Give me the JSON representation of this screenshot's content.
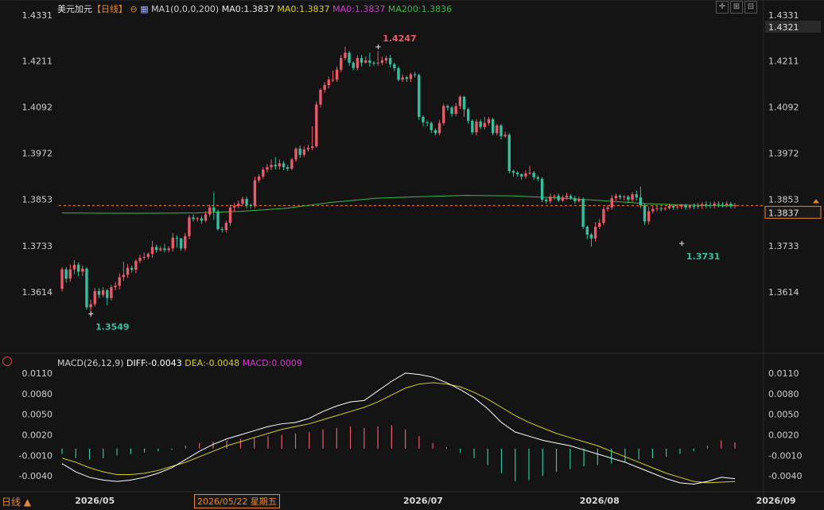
{
  "header": {
    "symbol": "美元加元",
    "period": "【日线】",
    "ma1_label": "MA1(0,0,0,200)",
    "ma0_a": "MA0:1.3837",
    "ma0_b": "MA0:1.3837",
    "ma0_c": "MA0:1.3837",
    "ma200": "MA200:1.3836"
  },
  "macd_header": {
    "label": "MACD(26,12,9)",
    "diff": "DIFF:-0.0043",
    "dea": "DEA:-0.0048",
    "macd": "MACD:0.0009"
  },
  "footer": {
    "period_button": "日线 ▲",
    "crosshair_date": "2026/05/22 星期五"
  },
  "price_axis": {
    "top_value": "1.4331",
    "highlight_value": "1.4321",
    "current_value": "1.3837",
    "ticks": [
      "1.4211",
      "1.4092",
      "1.3972",
      "1.3853",
      "1.3733",
      "1.3614"
    ]
  },
  "macd_axis": {
    "ticks": [
      "0.0110",
      "0.0080",
      "0.0050",
      "0.0020",
      "-0.0010",
      "-0.0040"
    ]
  },
  "colors": {
    "up": "#ef5a6a",
    "down": "#2ec4a0",
    "ma200": "#3cb84a",
    "diff": "#ffffff",
    "dea": "#d8d01c",
    "macd": "#d040d0",
    "accent": "#e8882a"
  },
  "chart_data": {
    "type": "candlestick",
    "price_range": [
      1.348,
      1.4331
    ],
    "x_labels": [
      "2026/05",
      "2026/07",
      "2026/08",
      "2026/09"
    ],
    "x_label_indices": [
      8,
      88,
      131,
      174
    ],
    "high_annotation": {
      "text": "1.4247",
      "index": 77,
      "value": 1.4247
    },
    "low_annotation_1": {
      "text": "1.3549",
      "index": 7,
      "value": 1.3549
    },
    "low_annotation_2": {
      "text": "1.3731",
      "index": 151,
      "value": 1.3731
    },
    "current_price": 1.3837,
    "ma200": [
      1.3818,
      1.3817,
      1.3817,
      1.3818,
      1.3822,
      1.383,
      1.3845,
      1.3856,
      1.386,
      1.3863,
      1.3862,
      1.3857,
      1.385,
      1.3842,
      1.3838,
      1.3836
    ],
    "candles": [
      [
        1.3622,
        1.3672,
        1.3678,
        1.3615
      ],
      [
        1.3672,
        1.3648,
        1.3678,
        1.3638
      ],
      [
        1.3648,
        1.3672,
        1.3685,
        1.364
      ],
      [
        1.3672,
        1.3684,
        1.3696,
        1.366
      ],
      [
        1.3684,
        1.3666,
        1.369,
        1.3655
      ],
      [
        1.3666,
        1.3674,
        1.3682,
        1.3655
      ],
      [
        1.3674,
        1.3574,
        1.3678,
        1.3568
      ],
      [
        1.3574,
        1.3582,
        1.3594,
        1.3549
      ],
      [
        1.3582,
        1.3616,
        1.3624,
        1.3576
      ],
      [
        1.3616,
        1.3606,
        1.3624,
        1.3598
      ],
      [
        1.3606,
        1.3618,
        1.3626,
        1.36
      ],
      [
        1.3618,
        1.3598,
        1.3622,
        1.358
      ],
      [
        1.3598,
        1.3626,
        1.3632,
        1.3592
      ],
      [
        1.3626,
        1.363,
        1.364,
        1.3618
      ],
      [
        1.363,
        1.3652,
        1.3662,
        1.362
      ],
      [
        1.3652,
        1.3658,
        1.3692,
        1.3642
      ],
      [
        1.3658,
        1.3676,
        1.3686,
        1.365
      ],
      [
        1.3676,
        1.3671,
        1.3682,
        1.3664
      ],
      [
        1.3671,
        1.3694,
        1.3698,
        1.3662
      ],
      [
        1.3694,
        1.3702,
        1.371,
        1.3688
      ],
      [
        1.3702,
        1.3704,
        1.3716,
        1.3696
      ],
      [
        1.3704,
        1.3712,
        1.3716,
        1.3698
      ],
      [
        1.3712,
        1.373,
        1.3746,
        1.3702
      ],
      [
        1.373,
        1.3722,
        1.3736,
        1.3715
      ],
      [
        1.3722,
        1.3726,
        1.3732,
        1.3718
      ],
      [
        1.3726,
        1.3722,
        1.3738,
        1.3716
      ],
      [
        1.3722,
        1.3726,
        1.3732,
        1.3716
      ],
      [
        1.3726,
        1.3754,
        1.3766,
        1.3718
      ],
      [
        1.3754,
        1.3752,
        1.376,
        1.3728
      ],
      [
        1.3752,
        1.3726,
        1.3754,
        1.372
      ],
      [
        1.3726,
        1.3758,
        1.3766,
        1.372
      ],
      [
        1.3758,
        1.3806,
        1.3812,
        1.375
      ],
      [
        1.3806,
        1.3802,
        1.3814,
        1.3796
      ],
      [
        1.3802,
        1.3804,
        1.3808,
        1.3796
      ],
      [
        1.3804,
        1.3798,
        1.381,
        1.379
      ],
      [
        1.3798,
        1.3814,
        1.3822,
        1.3794
      ],
      [
        1.3814,
        1.3832,
        1.384,
        1.3808
      ],
      [
        1.3832,
        1.3822,
        1.3872,
        1.38
      ],
      [
        1.3822,
        1.3776,
        1.3826,
        1.3772
      ],
      [
        1.3776,
        1.3774,
        1.3782,
        1.3768
      ],
      [
        1.3774,
        1.3792,
        1.3798,
        1.3768
      ],
      [
        1.3792,
        1.3832,
        1.384,
        1.3784
      ],
      [
        1.3832,
        1.3836,
        1.3844,
        1.382
      ],
      [
        1.3836,
        1.3842,
        1.385,
        1.383
      ],
      [
        1.3842,
        1.3854,
        1.386,
        1.3836
      ],
      [
        1.3854,
        1.3838,
        1.386,
        1.383
      ],
      [
        1.3838,
        1.3836,
        1.3842,
        1.383
      ],
      [
        1.3836,
        1.3902,
        1.3912,
        1.383
      ],
      [
        1.3902,
        1.3912,
        1.3918,
        1.3896
      ],
      [
        1.3912,
        1.393,
        1.3936,
        1.3906
      ],
      [
        1.393,
        1.3936,
        1.3944,
        1.3922
      ],
      [
        1.3936,
        1.3942,
        1.3956,
        1.3928
      ],
      [
        1.3942,
        1.3938,
        1.3962,
        1.393
      ],
      [
        1.3938,
        1.3946,
        1.3956,
        1.393
      ],
      [
        1.3946,
        1.3936,
        1.3952,
        1.3928
      ],
      [
        1.3936,
        1.3932,
        1.3942,
        1.3926
      ],
      [
        1.3932,
        1.3956,
        1.396,
        1.3928
      ],
      [
        1.3956,
        1.3984,
        1.3988,
        1.395
      ],
      [
        1.3984,
        1.3968,
        1.3992,
        1.396
      ],
      [
        1.3968,
        1.3982,
        1.399,
        1.3962
      ],
      [
        1.3982,
        1.3986,
        1.3994,
        1.3976
      ],
      [
        1.3986,
        1.399,
        1.4042,
        1.398
      ],
      [
        1.399,
        1.4098,
        1.4106,
        1.3986
      ],
      [
        1.4098,
        1.4136,
        1.414,
        1.409
      ],
      [
        1.4136,
        1.4148,
        1.4156,
        1.4128
      ],
      [
        1.4148,
        1.4162,
        1.417,
        1.414
      ],
      [
        1.4162,
        1.4162,
        1.4186,
        1.4156
      ],
      [
        1.4162,
        1.4188,
        1.4196,
        1.4156
      ],
      [
        1.4188,
        1.4218,
        1.4226,
        1.4182
      ],
      [
        1.4218,
        1.4232,
        1.4247,
        1.4212
      ],
      [
        1.4232,
        1.4206,
        1.4236,
        1.4198
      ],
      [
        1.4206,
        1.4192,
        1.421,
        1.4186
      ],
      [
        1.4192,
        1.4218,
        1.4224,
        1.4186
      ],
      [
        1.4218,
        1.4206,
        1.4226,
        1.4196
      ],
      [
        1.4206,
        1.4212,
        1.4222,
        1.4204
      ],
      [
        1.4212,
        1.4206,
        1.4232,
        1.4196
      ],
      [
        1.4206,
        1.4204,
        1.421,
        1.4198
      ],
      [
        1.4204,
        1.4206,
        1.4236,
        1.4198
      ],
      [
        1.4206,
        1.4212,
        1.4222,
        1.42
      ],
      [
        1.4212,
        1.4218,
        1.4224,
        1.4204
      ],
      [
        1.4218,
        1.4202,
        1.4226,
        1.4194
      ],
      [
        1.4202,
        1.4192,
        1.4206,
        1.4184
      ],
      [
        1.4192,
        1.4162,
        1.4196,
        1.4158
      ],
      [
        1.4162,
        1.4168,
        1.4176,
        1.4156
      ],
      [
        1.4168,
        1.4164,
        1.4172,
        1.4156
      ],
      [
        1.4164,
        1.4176,
        1.418,
        1.4156
      ],
      [
        1.4176,
        1.4174,
        1.4182,
        1.4168
      ],
      [
        1.4174,
        1.4066,
        1.4178,
        1.4058
      ],
      [
        1.4066,
        1.4052,
        1.407,
        1.4042
      ],
      [
        1.4052,
        1.405,
        1.4056,
        1.4042
      ],
      [
        1.405,
        1.4032,
        1.4054,
        1.4024
      ],
      [
        1.4032,
        1.4024,
        1.4036,
        1.4018
      ],
      [
        1.4024,
        1.405,
        1.4058,
        1.4018
      ],
      [
        1.405,
        1.4094,
        1.41,
        1.4044
      ],
      [
        1.4094,
        1.409,
        1.4098,
        1.4082
      ],
      [
        1.409,
        1.4074,
        1.4094,
        1.4066
      ],
      [
        1.4074,
        1.4094,
        1.4102,
        1.4068
      ],
      [
        1.4094,
        1.4118,
        1.4122,
        1.4086
      ],
      [
        1.4118,
        1.4086,
        1.412,
        1.4066
      ],
      [
        1.4086,
        1.4056,
        1.409,
        1.4048
      ],
      [
        1.4056,
        1.4026,
        1.406,
        1.402
      ],
      [
        1.4026,
        1.4054,
        1.406,
        1.4018
      ],
      [
        1.4054,
        1.404,
        1.406,
        1.4034
      ],
      [
        1.404,
        1.405,
        1.4066,
        1.4034
      ],
      [
        1.405,
        1.406,
        1.4066,
        1.4044
      ],
      [
        1.406,
        1.4024,
        1.4064,
        1.4018
      ],
      [
        1.4024,
        1.4044,
        1.4048,
        1.4018
      ],
      [
        1.4044,
        1.4016,
        1.4048,
        1.4008
      ],
      [
        1.4016,
        1.402,
        1.4028,
        1.4012
      ],
      [
        1.402,
        1.3926,
        1.4024,
        1.392
      ],
      [
        1.3926,
        1.3922,
        1.393,
        1.3912
      ],
      [
        1.3922,
        1.3918,
        1.3926,
        1.3912
      ],
      [
        1.3918,
        1.3912,
        1.392,
        1.3904
      ],
      [
        1.3912,
        1.392,
        1.3928,
        1.3906
      ],
      [
        1.392,
        1.3922,
        1.394,
        1.3916
      ],
      [
        1.3922,
        1.391,
        1.3926,
        1.3904
      ],
      [
        1.391,
        1.3906,
        1.3914,
        1.39
      ],
      [
        1.3906,
        1.3852,
        1.391,
        1.3846
      ],
      [
        1.3852,
        1.3848,
        1.3856,
        1.3842
      ],
      [
        1.3848,
        1.386,
        1.3868,
        1.3842
      ],
      [
        1.386,
        1.3862,
        1.3866,
        1.3852
      ],
      [
        1.3862,
        1.385,
        1.3868,
        1.3846
      ],
      [
        1.385,
        1.3858,
        1.3864,
        1.3846
      ],
      [
        1.3858,
        1.3862,
        1.387,
        1.3852
      ],
      [
        1.3862,
        1.3856,
        1.3866,
        1.3852
      ],
      [
        1.3856,
        1.3848,
        1.3862,
        1.3842
      ],
      [
        1.3848,
        1.3854,
        1.386,
        1.3844
      ],
      [
        1.3854,
        1.3782,
        1.3858,
        1.3776
      ],
      [
        1.3782,
        1.3762,
        1.3786,
        1.375
      ],
      [
        1.3762,
        1.3752,
        1.3766,
        1.3731
      ],
      [
        1.3752,
        1.3782,
        1.3794,
        1.3744
      ],
      [
        1.3782,
        1.3792,
        1.3802,
        1.3776
      ],
      [
        1.3792,
        1.3828,
        1.3834,
        1.3786
      ],
      [
        1.3828,
        1.3832,
        1.3838,
        1.3822
      ],
      [
        1.3832,
        1.3856,
        1.3864,
        1.3826
      ],
      [
        1.3856,
        1.3862,
        1.3868,
        1.385
      ],
      [
        1.3862,
        1.3858,
        1.3866,
        1.3852
      ],
      [
        1.3858,
        1.386,
        1.3864,
        1.385
      ],
      [
        1.386,
        1.3852,
        1.3864,
        1.3846
      ],
      [
        1.3852,
        1.3866,
        1.3872,
        1.3846
      ],
      [
        1.3866,
        1.3858,
        1.3876,
        1.385
      ],
      [
        1.3858,
        1.3838,
        1.3886,
        1.383
      ],
      [
        1.3838,
        1.3796,
        1.3842,
        1.3788
      ],
      [
        1.3796,
        1.3822,
        1.3834,
        1.3788
      ],
      [
        1.3822,
        1.3828,
        1.3838,
        1.3816
      ],
      [
        1.3828,
        1.383,
        1.3836,
        1.3822
      ],
      [
        1.383,
        1.3828,
        1.3834,
        1.3822
      ],
      [
        1.3828,
        1.383,
        1.3834,
        1.3824
      ],
      [
        1.383,
        1.3836,
        1.3842,
        1.3826
      ],
      [
        1.3836,
        1.3832,
        1.384,
        1.3826
      ],
      [
        1.3832,
        1.3834,
        1.3838,
        1.3826
      ],
      [
        1.3834,
        1.3838,
        1.3842,
        1.3828
      ],
      [
        1.3838,
        1.3832,
        1.3842,
        1.3826
      ],
      [
        1.3832,
        1.3836,
        1.384,
        1.3828
      ],
      [
        1.3836,
        1.3834,
        1.3842,
        1.3828
      ],
      [
        1.3834,
        1.3836,
        1.3844,
        1.3828
      ],
      [
        1.3836,
        1.384,
        1.3846,
        1.3828
      ],
      [
        1.384,
        1.3838,
        1.3848,
        1.383
      ],
      [
        1.3838,
        1.3836,
        1.3846,
        1.383
      ],
      [
        1.3836,
        1.3842,
        1.3848,
        1.383
      ],
      [
        1.3842,
        1.384,
        1.3848,
        1.3832
      ],
      [
        1.384,
        1.3838,
        1.3846,
        1.3832
      ],
      [
        1.3838,
        1.3842,
        1.3848,
        1.3832
      ],
      [
        1.3842,
        1.3836,
        1.3846,
        1.383
      ],
      [
        1.3836,
        1.3838,
        1.3844,
        1.383
      ]
    ],
    "macd_range": [
      -0.0056,
      0.0118
    ],
    "diff": [
      -0.0022,
      -0.0034,
      -0.0042,
      -0.0046,
      -0.0048,
      -0.0046,
      -0.0042,
      -0.0036,
      -0.0028,
      -0.0016,
      -0.0004,
      0.0006,
      0.0014,
      0.002,
      0.0026,
      0.0032,
      0.0036,
      0.0038,
      0.0044,
      0.0054,
      0.0062,
      0.0068,
      0.007,
      0.0084,
      0.0098,
      0.011,
      0.0108,
      0.0104,
      0.0096,
      0.0086,
      0.0074,
      0.0058,
      0.0038,
      0.0024,
      0.0018,
      0.0012,
      0.0008,
      0.0004,
      -0.0002,
      -0.0008,
      -0.0014,
      -0.002,
      -0.0028,
      -0.0036,
      -0.0044,
      -0.005,
      -0.0052,
      -0.0048,
      -0.0042,
      -0.0044
    ],
    "dea": [
      -0.0014,
      -0.002,
      -0.0028,
      -0.0034,
      -0.0038,
      -0.0038,
      -0.0036,
      -0.0032,
      -0.0026,
      -0.002,
      -0.0012,
      -0.0004,
      0.0004,
      0.001,
      0.0016,
      0.0022,
      0.0028,
      0.0032,
      0.0036,
      0.0042,
      0.0048,
      0.0054,
      0.006,
      0.0068,
      0.0078,
      0.0088,
      0.0094,
      0.0096,
      0.0094,
      0.009,
      0.0082,
      0.0072,
      0.006,
      0.0048,
      0.0038,
      0.003,
      0.0022,
      0.0016,
      0.001,
      0.0004,
      -0.0004,
      -0.0012,
      -0.002,
      -0.0028,
      -0.0036,
      -0.0042,
      -0.0048,
      -0.005,
      -0.0049,
      -0.0048
    ],
    "hist": [
      -0.0008,
      -0.0014,
      -0.0016,
      -0.0014,
      -0.001,
      -0.0008,
      -0.0006,
      -0.0004,
      -0.0002,
      0.0004,
      0.0008,
      0.001,
      0.0012,
      0.0014,
      0.0016,
      0.0018,
      0.002,
      0.0022,
      0.0024,
      0.0028,
      0.003,
      0.0032,
      0.003,
      0.0032,
      0.0034,
      0.0028,
      0.0018,
      0.0008,
      0.0002,
      -0.0006,
      -0.0014,
      -0.0024,
      -0.0036,
      -0.0048,
      -0.0046,
      -0.004,
      -0.0034,
      -0.003,
      -0.0026,
      -0.0024,
      -0.0022,
      -0.002,
      -0.0016,
      -0.0014,
      -0.0012,
      -0.0008,
      -0.0004,
      0.0004,
      0.0012,
      0.0009
    ]
  }
}
